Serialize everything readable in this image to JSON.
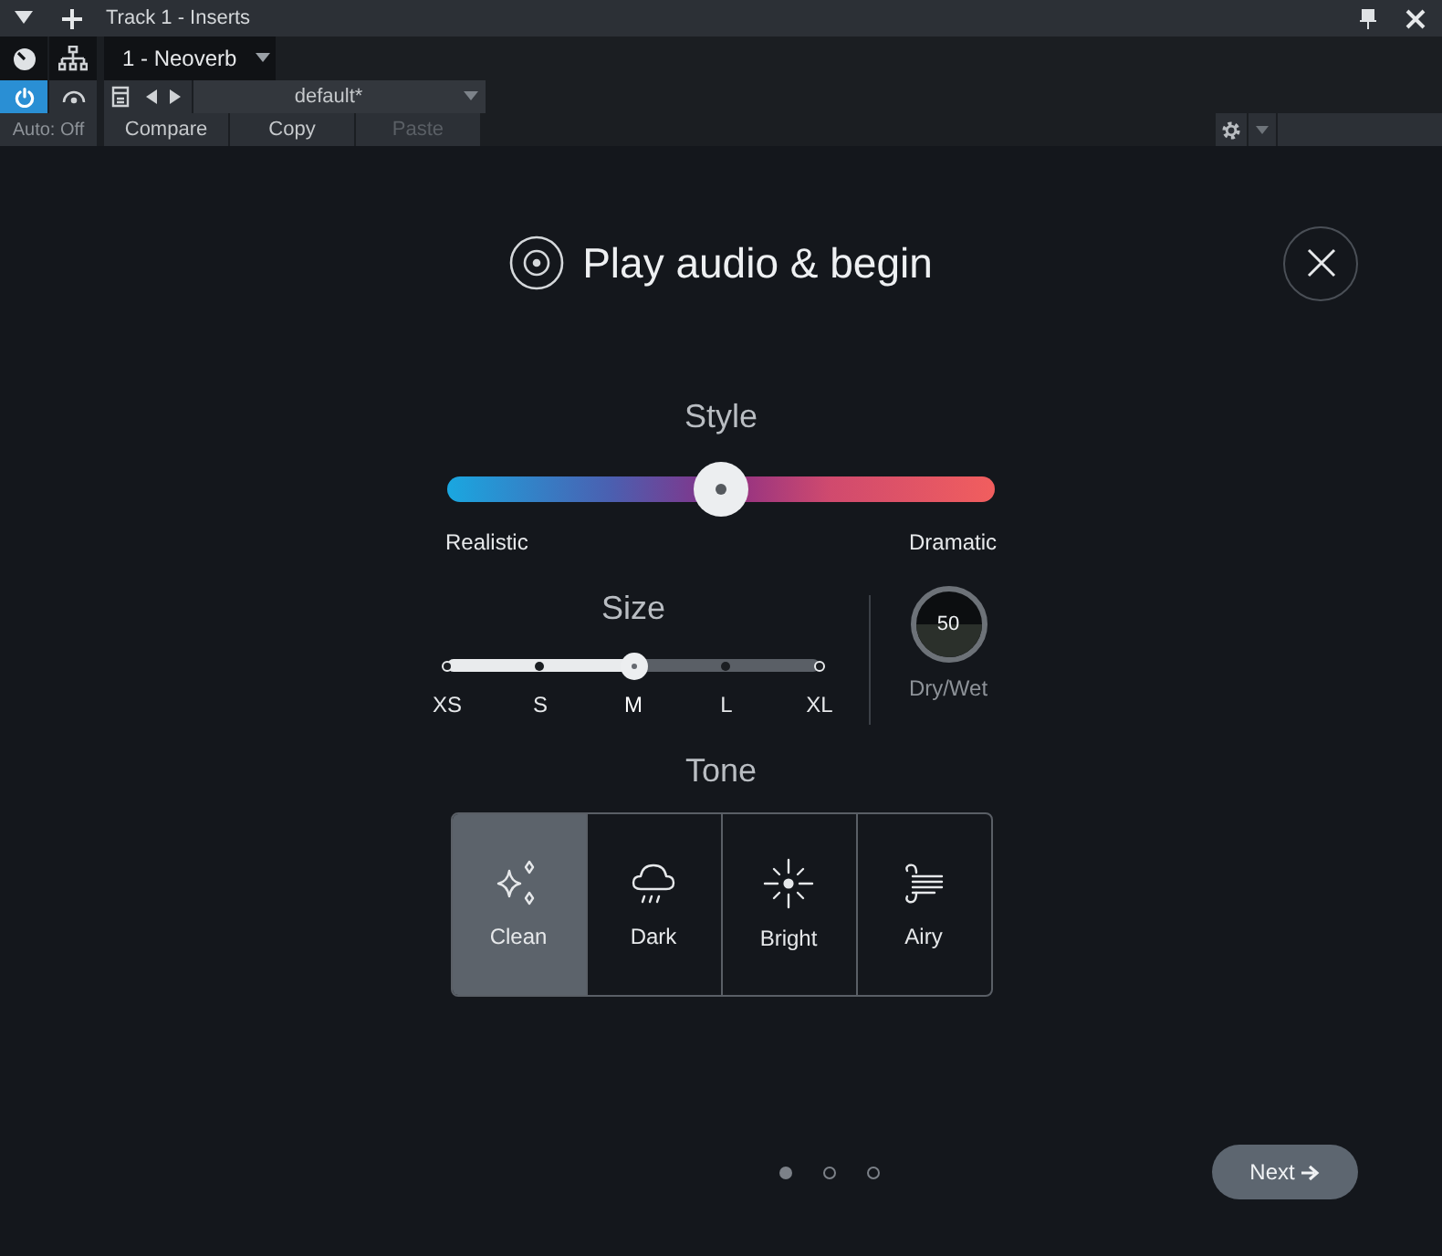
{
  "window": {
    "title": "Track 1 - Inserts"
  },
  "insert_tab": {
    "label": "1 - Neoverb"
  },
  "toolbar": {
    "power": {
      "on": true
    },
    "preset": {
      "value": "default*"
    },
    "automation": {
      "label": "Auto: Off"
    },
    "buttons": [
      {
        "label": "Compare",
        "disabled": false
      },
      {
        "label": "Copy",
        "disabled": false
      },
      {
        "label": "Paste",
        "disabled": true
      }
    ]
  },
  "plugin": {
    "title": "Play audio & begin",
    "style": {
      "label": "Style",
      "level": 0.5,
      "min_label": "Realistic",
      "max_label": "Dramatic"
    },
    "size": {
      "label": "Size",
      "steps": [
        {
          "label": "XS",
          "selected": false
        },
        {
          "label": "S",
          "selected": false
        },
        {
          "label": "M",
          "selected": true
        },
        {
          "label": "L",
          "selected": false
        },
        {
          "label": "XL",
          "selected": false
        }
      ]
    },
    "dry_wet": {
      "value": "50",
      "label": "Dry/Wet",
      "level": 0.5
    },
    "tone": {
      "label": "Tone",
      "options": [
        {
          "label": "Clean",
          "kind": "sparkle",
          "selected": true
        },
        {
          "label": "Dark",
          "kind": "rain",
          "selected": false
        },
        {
          "label": "Bright",
          "kind": "sun",
          "selected": false
        },
        {
          "label": "Airy",
          "kind": "wind",
          "selected": false
        }
      ]
    },
    "pages": [
      {
        "selected": true
      },
      {
        "selected": false
      },
      {
        "selected": false
      }
    ],
    "next_button": {
      "label": "Next"
    }
  }
}
